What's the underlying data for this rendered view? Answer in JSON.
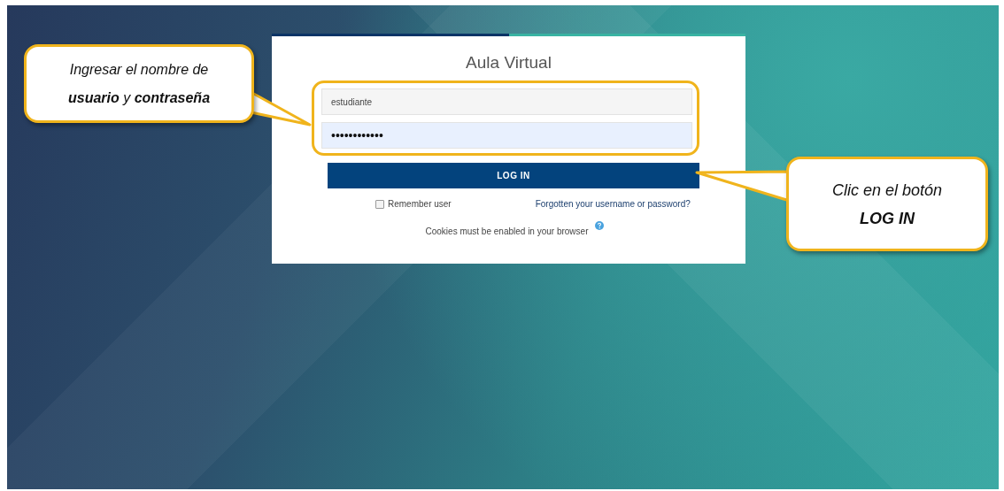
{
  "login": {
    "title": "Aula Virtual",
    "username": {
      "value": "estudiante"
    },
    "password": {
      "value": "••••••••••••"
    },
    "login_button": "LOG IN",
    "remember": {
      "label": "Remember user",
      "checked": false
    },
    "forgot_link": "Forgotten your username or password?",
    "cookies_notice": "Cookies must be enabled in your browser"
  },
  "callouts": [
    {
      "lines": [
        "Ingresar el nombre de",
        "**usuario** y **contraseña**"
      ]
    },
    {
      "lines": [
        "Clic en el botón",
        "**LOG IN**"
      ]
    }
  ]
}
